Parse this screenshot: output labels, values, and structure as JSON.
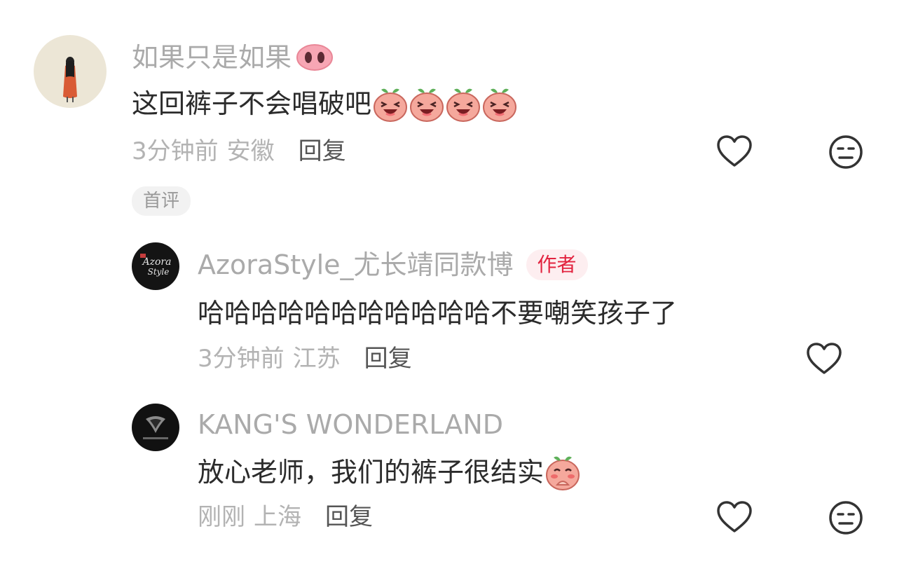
{
  "comments": [
    {
      "username": "如果只是如果",
      "username_emoji": "pig-nose-emoji",
      "text": "这回裤子不会唱破吧",
      "text_emojis": [
        "laughing-peach-emoji",
        "laughing-peach-emoji",
        "laughing-peach-emoji",
        "laughing-peach-emoji"
      ],
      "time": "3分钟前",
      "location": "安徽",
      "reply_label": "回复",
      "badge": "首评",
      "avatar": "girl-illustration-avatar"
    },
    {
      "username": "AzoraStyle_尤长靖同款博",
      "author_badge": "作者",
      "text": "哈哈哈哈哈哈哈哈哈哈哈不要嘲笑孩子了",
      "time": "3分钟前",
      "location": "江苏",
      "reply_label": "回复",
      "avatar_text_line1": "Azora",
      "avatar_text_line2": "Style"
    },
    {
      "username": "KANG'S WONDERLAND",
      "text": "放心老师，我们的裤子很结实",
      "text_emoji": "praying-peach-emoji",
      "time": "刚刚",
      "location": "上海",
      "reply_label": "回复",
      "avatar": "dark-logo-avatar"
    }
  ],
  "colors": {
    "author_badge_text": "#e2233f",
    "author_badge_bg": "#fdeef0",
    "peach": "#f7a9a0"
  }
}
